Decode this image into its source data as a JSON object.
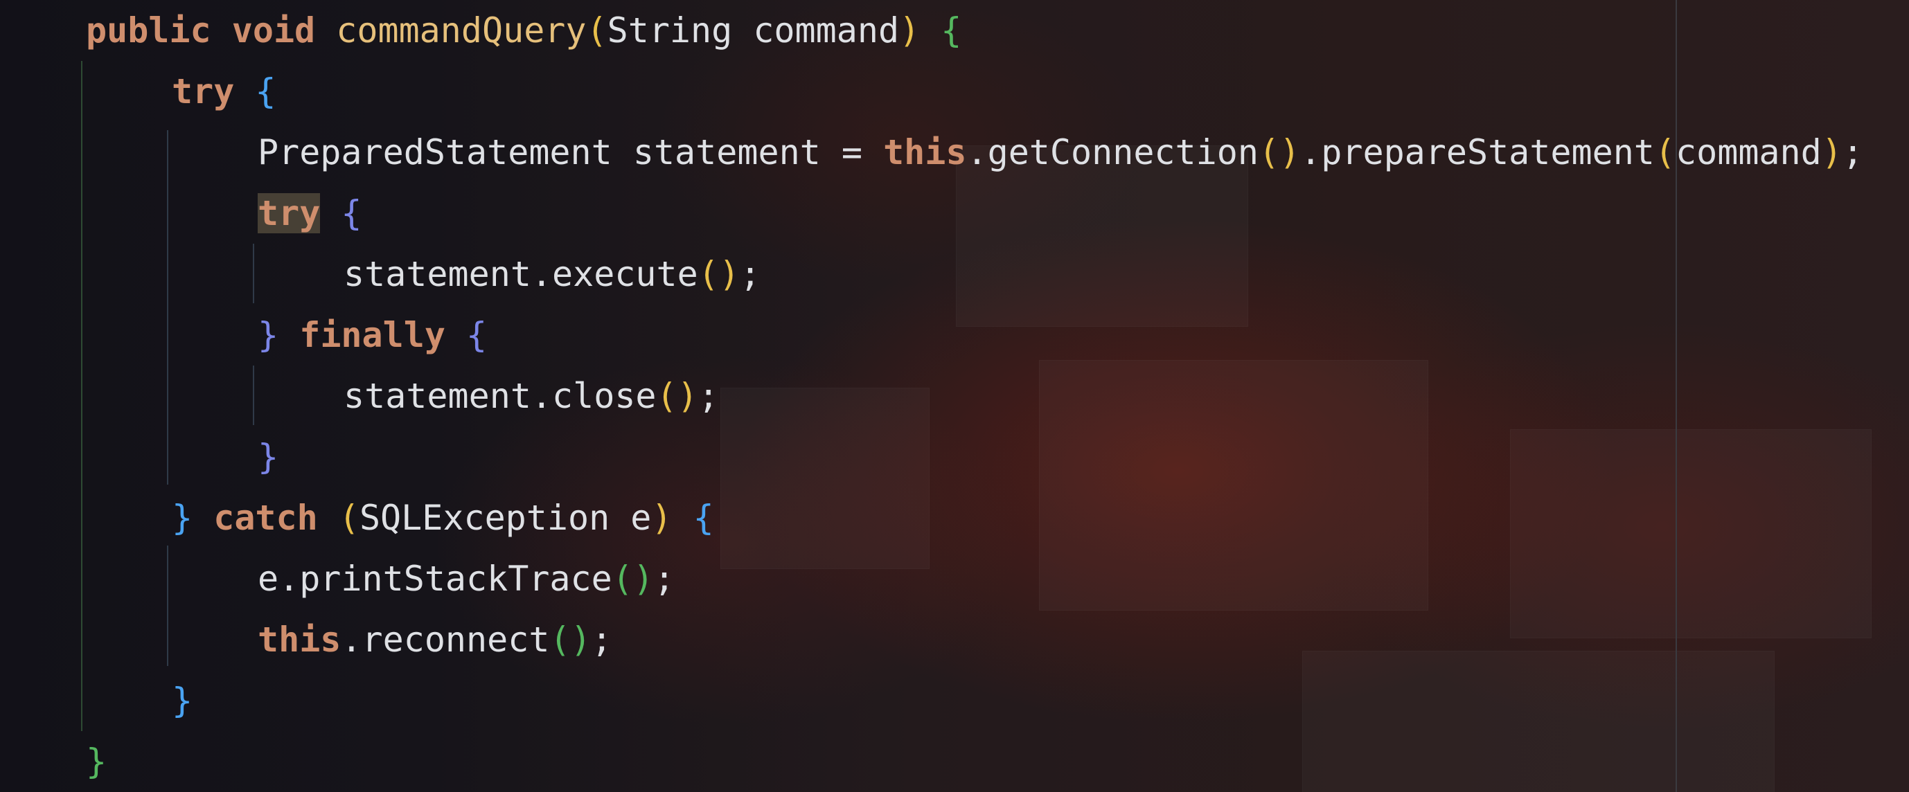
{
  "code": {
    "lines": [
      [
        "public",
        " ",
        "void",
        " ",
        "commandQuery",
        "(",
        "String command",
        ")",
        " ",
        "{"
      ],
      [
        "try",
        " ",
        "{"
      ],
      [
        "PreparedStatement statement = ",
        "this",
        ".getConnection",
        "()",
        ".prepareStatement",
        "(",
        "command",
        ")",
        ";"
      ],
      [
        "try",
        " ",
        "{"
      ],
      [
        "statement.execute",
        "()",
        ";"
      ],
      [
        "}",
        " ",
        "finally",
        " ",
        "{"
      ],
      [
        "statement.close",
        "()",
        ";"
      ],
      [
        "}"
      ],
      [
        "}",
        " ",
        "catch",
        " ",
        "(",
        "SQLException e",
        ")",
        " ",
        "{"
      ],
      [
        "e.printStackTrace",
        "()",
        ";"
      ],
      [
        "this",
        ".reconnect",
        "()",
        ";"
      ],
      [
        "}"
      ],
      [
        "}"
      ]
    ]
  },
  "colors": {
    "keyword": "#cf8e6d",
    "method_declaration": "#e6c07b",
    "default_text": "#dfe1e5",
    "bracket_level_1": "#e8bf4a",
    "bracket_level_2": "#55b85f",
    "bracket_level_3": "#4aa3f2",
    "bracket_level_4": "#7c86e8",
    "highlight_background": "#474035"
  }
}
